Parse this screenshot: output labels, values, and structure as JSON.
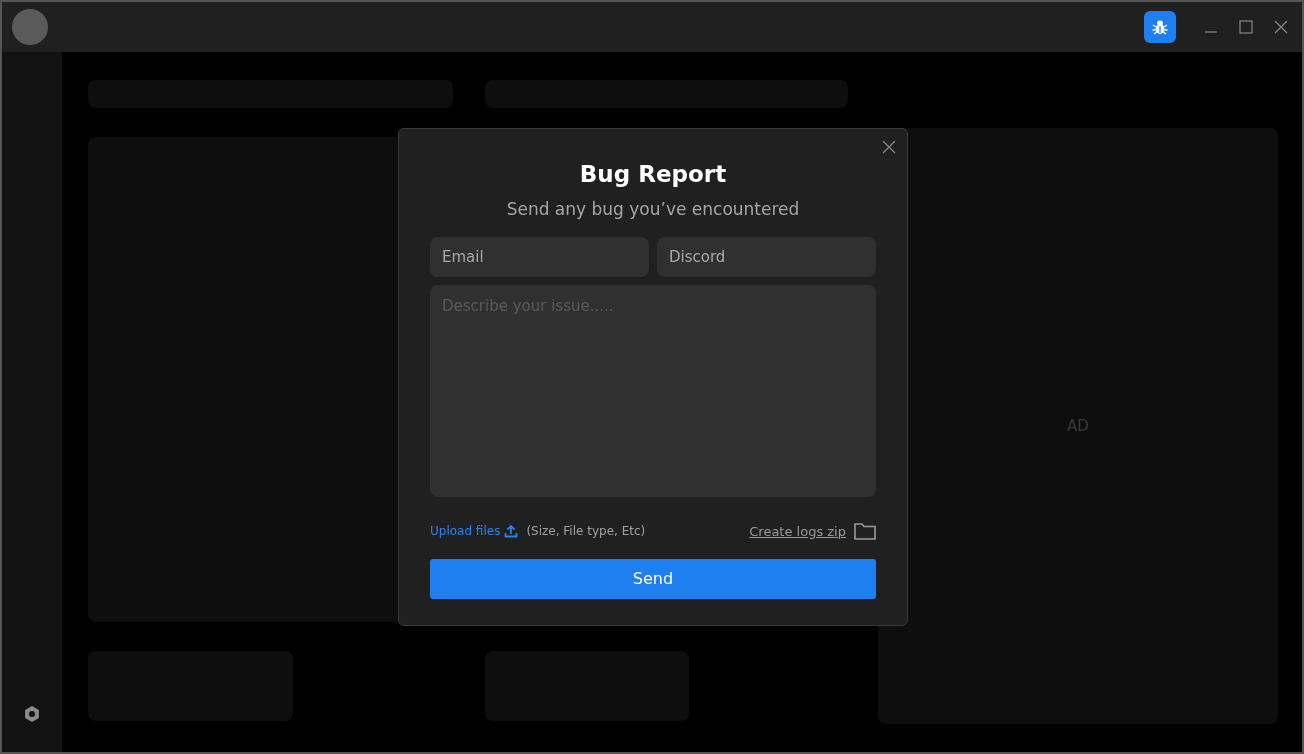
{
  "ad_panel": {
    "label": "AD"
  },
  "dialog": {
    "title": "Bug Report",
    "subtitle": "Send any bug you’ve encountered",
    "fields": [
      {
        "placeholder": "Email"
      },
      {
        "placeholder": "Discord"
      }
    ],
    "description": {
      "placeholder": "Describe your issue....."
    },
    "upload_link": "Upload files",
    "upload_hint": "(Size, File type, Etc)",
    "logs_link": "Create logs zip",
    "send_button": "Send"
  }
}
